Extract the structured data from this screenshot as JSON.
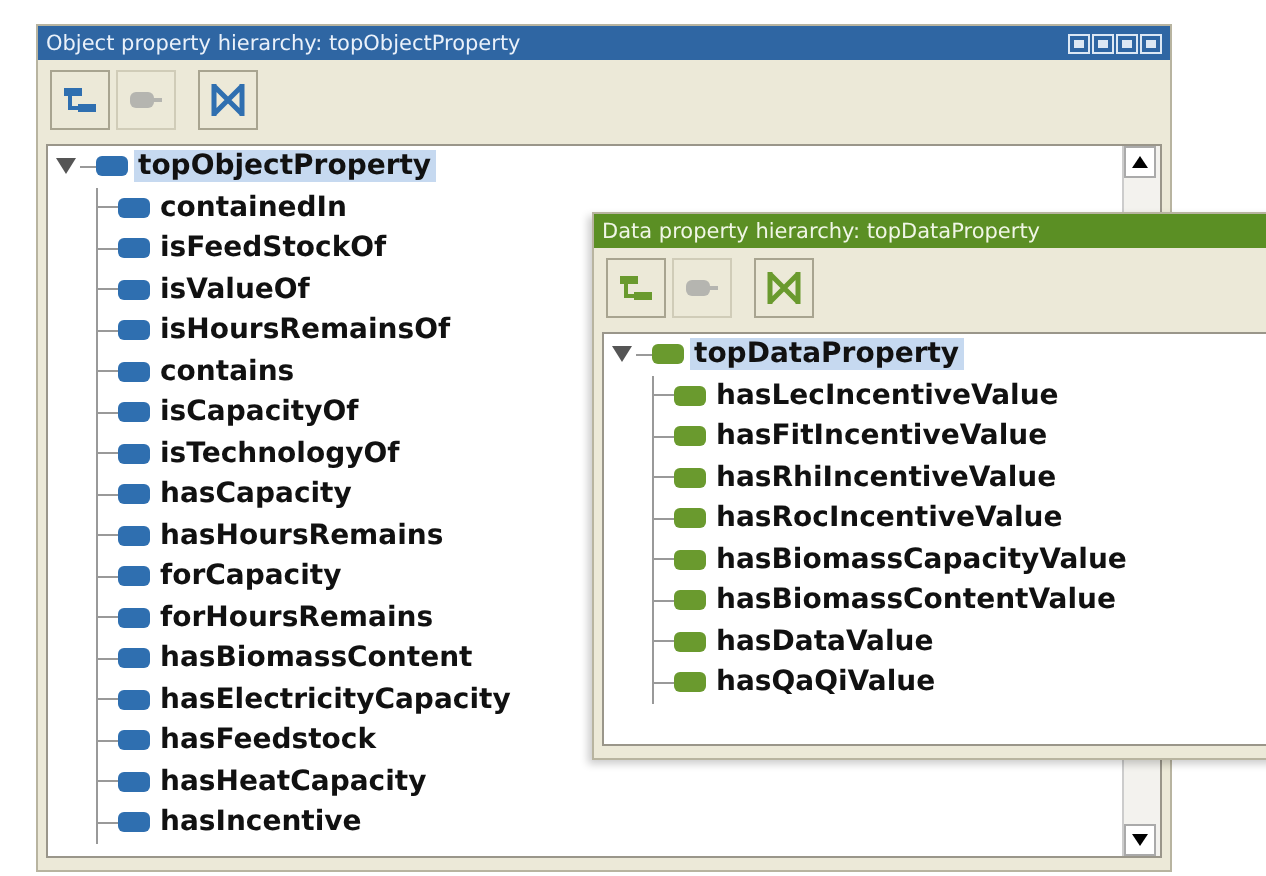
{
  "object_panel": {
    "title": "Object property hierarchy: topObjectProperty",
    "toolbar": [
      {
        "kind": "hierarchy",
        "disabled": false
      },
      {
        "kind": "delete",
        "disabled": true
      },
      {
        "kind": "cross",
        "disabled": false
      }
    ],
    "tree": {
      "label": "topObjectProperty",
      "selected": true,
      "expanded": true,
      "children": [
        {
          "label": "containedIn",
          "selected": false
        },
        {
          "label": "isFeedStockOf",
          "selected": false
        },
        {
          "label": "isValueOf",
          "selected": false
        },
        {
          "label": "isHoursRemainsOf",
          "selected": false
        },
        {
          "label": "contains",
          "selected": false
        },
        {
          "label": "isCapacityOf",
          "selected": false
        },
        {
          "label": "isTechnologyOf",
          "selected": false
        },
        {
          "label": "hasCapacity",
          "selected": false
        },
        {
          "label": "hasHoursRemains",
          "selected": false
        },
        {
          "label": "forCapacity",
          "selected": false
        },
        {
          "label": "forHoursRemains",
          "selected": false
        },
        {
          "label": "hasBiomassContent",
          "selected": false
        },
        {
          "label": "hasElectricityCapacity",
          "selected": false
        },
        {
          "label": "hasFeedstock",
          "selected": false
        },
        {
          "label": "hasHeatCapacity",
          "selected": false
        },
        {
          "label": "hasIncentive",
          "selected": false
        }
      ]
    }
  },
  "data_panel": {
    "title": "Data property hierarchy: topDataProperty",
    "toolbar": [
      {
        "kind": "hierarchy",
        "disabled": false
      },
      {
        "kind": "delete",
        "disabled": true
      },
      {
        "kind": "cross",
        "disabled": false
      }
    ],
    "tree": {
      "label": "topDataProperty",
      "selected": true,
      "expanded": true,
      "children": [
        {
          "label": "hasLecIncentiveValue",
          "selected": false
        },
        {
          "label": "hasFitIncentiveValue",
          "selected": false
        },
        {
          "label": "hasRhiIncentiveValue",
          "selected": false
        },
        {
          "label": "hasRocIncentiveValue",
          "selected": false
        },
        {
          "label": "hasBiomassCapacityValue",
          "selected": false
        },
        {
          "label": "hasBiomassContentValue",
          "selected": false
        },
        {
          "label": "hasDataValue",
          "selected": false
        },
        {
          "label": "hasQaQiValue",
          "selected": false
        }
      ]
    }
  }
}
